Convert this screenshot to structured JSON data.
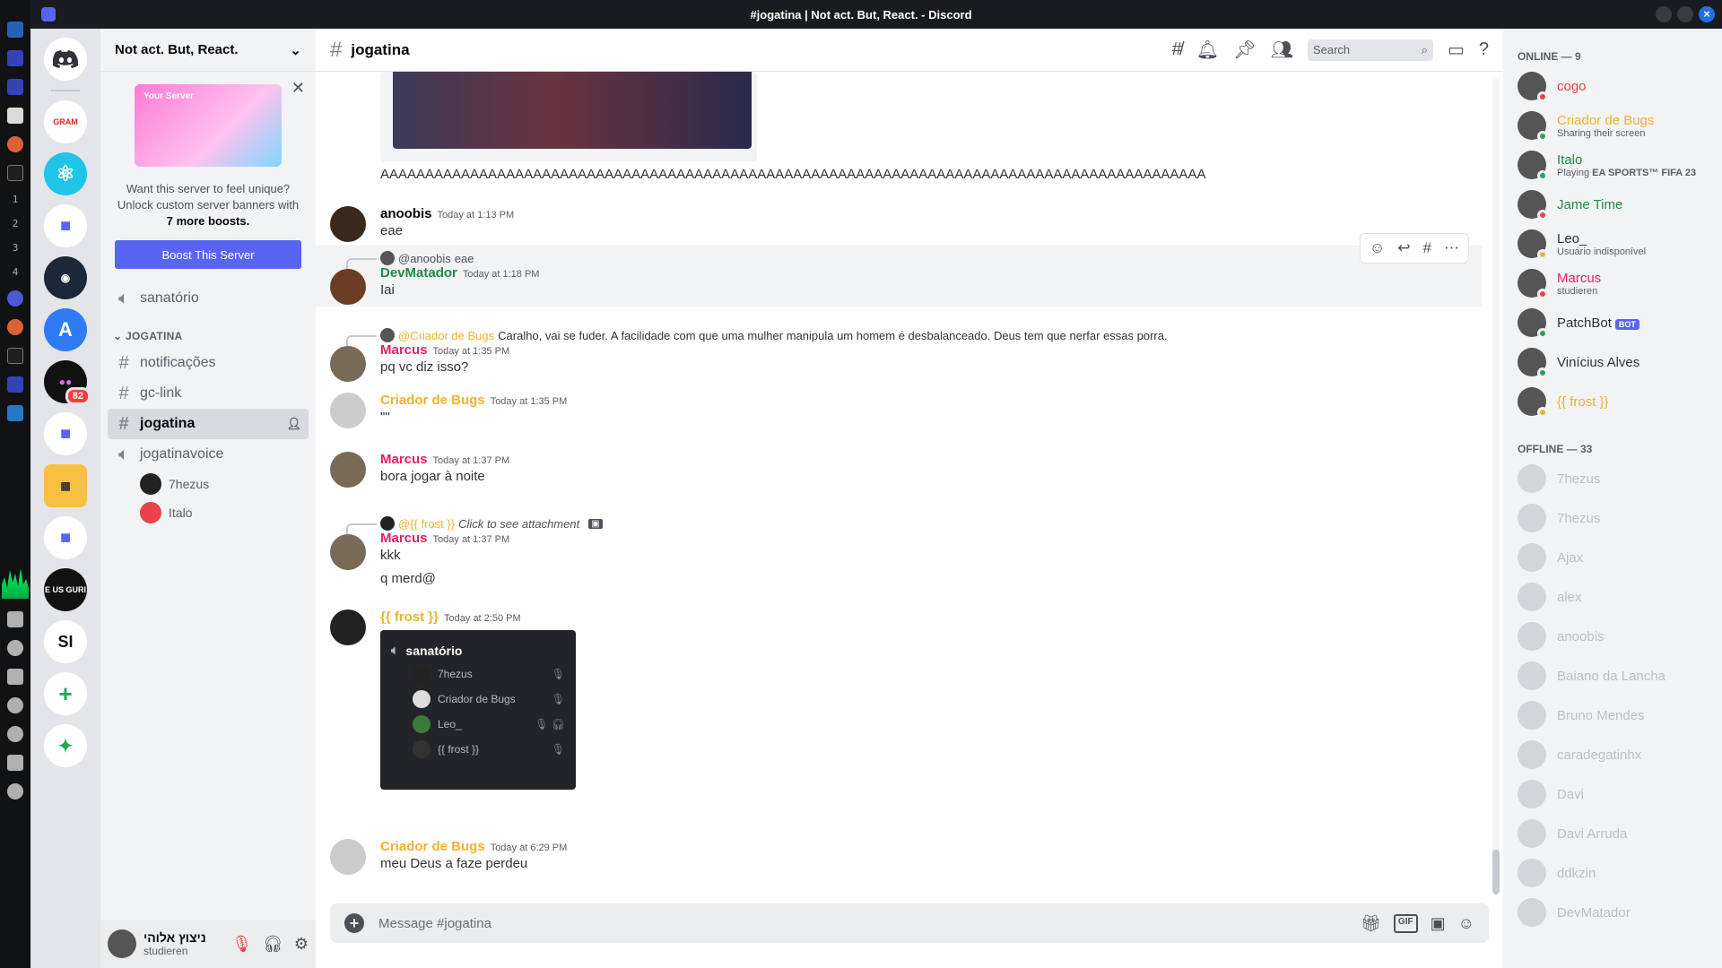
{
  "window": {
    "title": "#jogatina | Not act. But, React. - Discord"
  },
  "colors": {
    "accent": "#5865f2",
    "online": "#23a55a",
    "idle": "#f0b232",
    "dnd": "#f23f43",
    "marcus": "#e91e63",
    "devmatador": "#1f8b4c",
    "yellow": "#f0b232"
  },
  "os_bar": {
    "workspaces": [
      "1",
      "2",
      "3",
      "4"
    ]
  },
  "servers": [
    {
      "name": "discord-home",
      "icon": "discord-icon"
    },
    {
      "name": "gram",
      "initials": "GRAM"
    },
    {
      "name": "react",
      "icon": "react-icon"
    },
    {
      "name": "folder-1",
      "icon": "folder-icon"
    },
    {
      "name": "steam",
      "icon": "steam-icon"
    },
    {
      "name": "appstore",
      "icon": "appstore-icon"
    },
    {
      "name": "dev",
      "badge": "82"
    },
    {
      "name": "folder-2",
      "icon": "folder-icon"
    },
    {
      "name": "rubik",
      "icon": "cube-icon"
    },
    {
      "name": "folder-3",
      "icon": "folder-icon"
    },
    {
      "name": "eusguri",
      "initials": "E US GURI"
    },
    {
      "name": "si",
      "initials": "SI"
    }
  ],
  "sidebar": {
    "server_name": "Not act. But, React.",
    "boost": {
      "banner_label": "Your Server",
      "line1": "Want this server to feel unique? Unlock custom server banners with",
      "line2": "7 more boosts.",
      "button": "Boost This Server"
    },
    "top_voice": "sanatório",
    "category": "JOGATINA",
    "channels": [
      {
        "name": "notificações",
        "type": "text"
      },
      {
        "name": "gc-link",
        "type": "text"
      },
      {
        "name": "jogatina",
        "type": "text",
        "active": true
      },
      {
        "name": "jogatinavoice",
        "type": "voice"
      }
    ],
    "voice_users": [
      "7hezus",
      "Italo"
    ],
    "user": {
      "name": "ניצוץ אלוהי",
      "status": "studieren"
    }
  },
  "main": {
    "channel": "jogatina",
    "search_placeholder": "Search",
    "composer_placeholder": "Message #jogatina"
  },
  "messages": {
    "spam": "AAAAAAAAAAAAAAAAAAAAAAAAAAAAAAAAAAAAAAAAAAAAAAAAAAAAAAAAAAAAAAAAAAAAAAAAAAAAAAAAAAAAAAAAAAAA",
    "m1": {
      "author": "anoobis",
      "time": "Today at 1:13 PM",
      "text": "eae"
    },
    "m2": {
      "reply_to": "@anoobis",
      "reply_text": "eae",
      "author": "DevMatador",
      "time": "Today at 1:18 PM",
      "text": "Iai"
    },
    "m3": {
      "reply_to": "@Criador de Bugs",
      "reply_text": "Caralho, vai se fuder. A facilidade com que uma mulher manipula um homem é desbalanceado. Deus tem que nerfar essas porra.",
      "author": "Marcus",
      "time": "Today at 1:35 PM",
      "text": "pq vc diz isso?"
    },
    "m4": {
      "author": "Criador de Bugs",
      "time": "Today at 1:35 PM",
      "text": "\"\""
    },
    "m5": {
      "author": "Marcus",
      "time": "Today at 1:37 PM",
      "text": "bora jogar à noite"
    },
    "m6": {
      "reply_to": "@{{ frost }}",
      "reply_text": "Click to see attachment",
      "author": "Marcus",
      "time": "Today at 1:37 PM",
      "text": "kkk",
      "text2": "q merd@"
    },
    "m7": {
      "author": "{{ frost }}",
      "time": "Today at 2:50 PM",
      "embed": {
        "channel": "sanatório",
        "members": [
          "7hezus",
          "Criador de Bugs",
          "Leo_",
          "{{ frost }}"
        ]
      }
    },
    "m8": {
      "author": "Criador de Bugs",
      "time": "Today at 6:29 PM",
      "text": "meu Deus a faze perdeu"
    }
  },
  "members": {
    "online_header": "ONLINE — 9",
    "online": [
      {
        "name": "cogo",
        "color": "#f23f43",
        "status": "dnd"
      },
      {
        "name": "Criador de Bugs",
        "sub": "Sharing their screen",
        "color": "#f0b232",
        "status": "online"
      },
      {
        "name": "Italo",
        "sub": "Playing",
        "sub_bold": "EA SPORTS™ FIFA 23",
        "color": "#1f8b4c",
        "status": "online"
      },
      {
        "name": "Jame Time",
        "color": "#1f8b4c",
        "status": "dnd"
      },
      {
        "name": "Leo_",
        "sub": "Usuário indisponível",
        "color": "#313338",
        "status": "idle"
      },
      {
        "name": "Marcus",
        "sub": "studieren",
        "color": "#e91e63",
        "status": "dnd"
      },
      {
        "name": "PatchBot",
        "bot": "BOT",
        "color": "#313338",
        "status": "online"
      },
      {
        "name": "Vinícius Alves",
        "color": "#313338",
        "status": "online"
      },
      {
        "name": "{{ frost }}",
        "color": "#f0b232",
        "status": "idle"
      }
    ],
    "offline_header": "OFFLINE — 33",
    "offline": [
      "7hezus",
      "7hezus",
      "Ajax",
      "alex",
      "anoobis",
      "Baiano da Lancha",
      "Bruno Mendes",
      "caradegatinhx",
      "Davi",
      "Davi Arruda",
      "ddkzin",
      "DevMatador"
    ]
  }
}
